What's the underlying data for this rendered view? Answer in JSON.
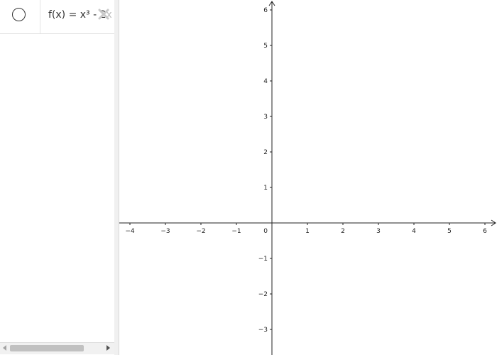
{
  "algebra": {
    "items": [
      {
        "formula_main": "f(x) = x³ - 2",
        "formula_faded": "x -"
      }
    ]
  },
  "icons": {
    "visibility": "circle-toggle-icon",
    "delete": "delete-x-icon",
    "scroll_left": "arrow-left-icon",
    "scroll_right": "arrow-right-icon"
  },
  "graph": {
    "x_range": [
      -4,
      6
    ],
    "y_range": [
      -3,
      6
    ],
    "x_ticks": [
      "−4",
      "−3",
      "−2",
      "−1",
      "1",
      "2",
      "3",
      "4",
      "5",
      "6"
    ],
    "y_ticks": [
      "6",
      "5",
      "4",
      "3",
      "2",
      "1",
      "−1",
      "−2",
      "−3"
    ],
    "origin_label": "0",
    "grid": false
  }
}
